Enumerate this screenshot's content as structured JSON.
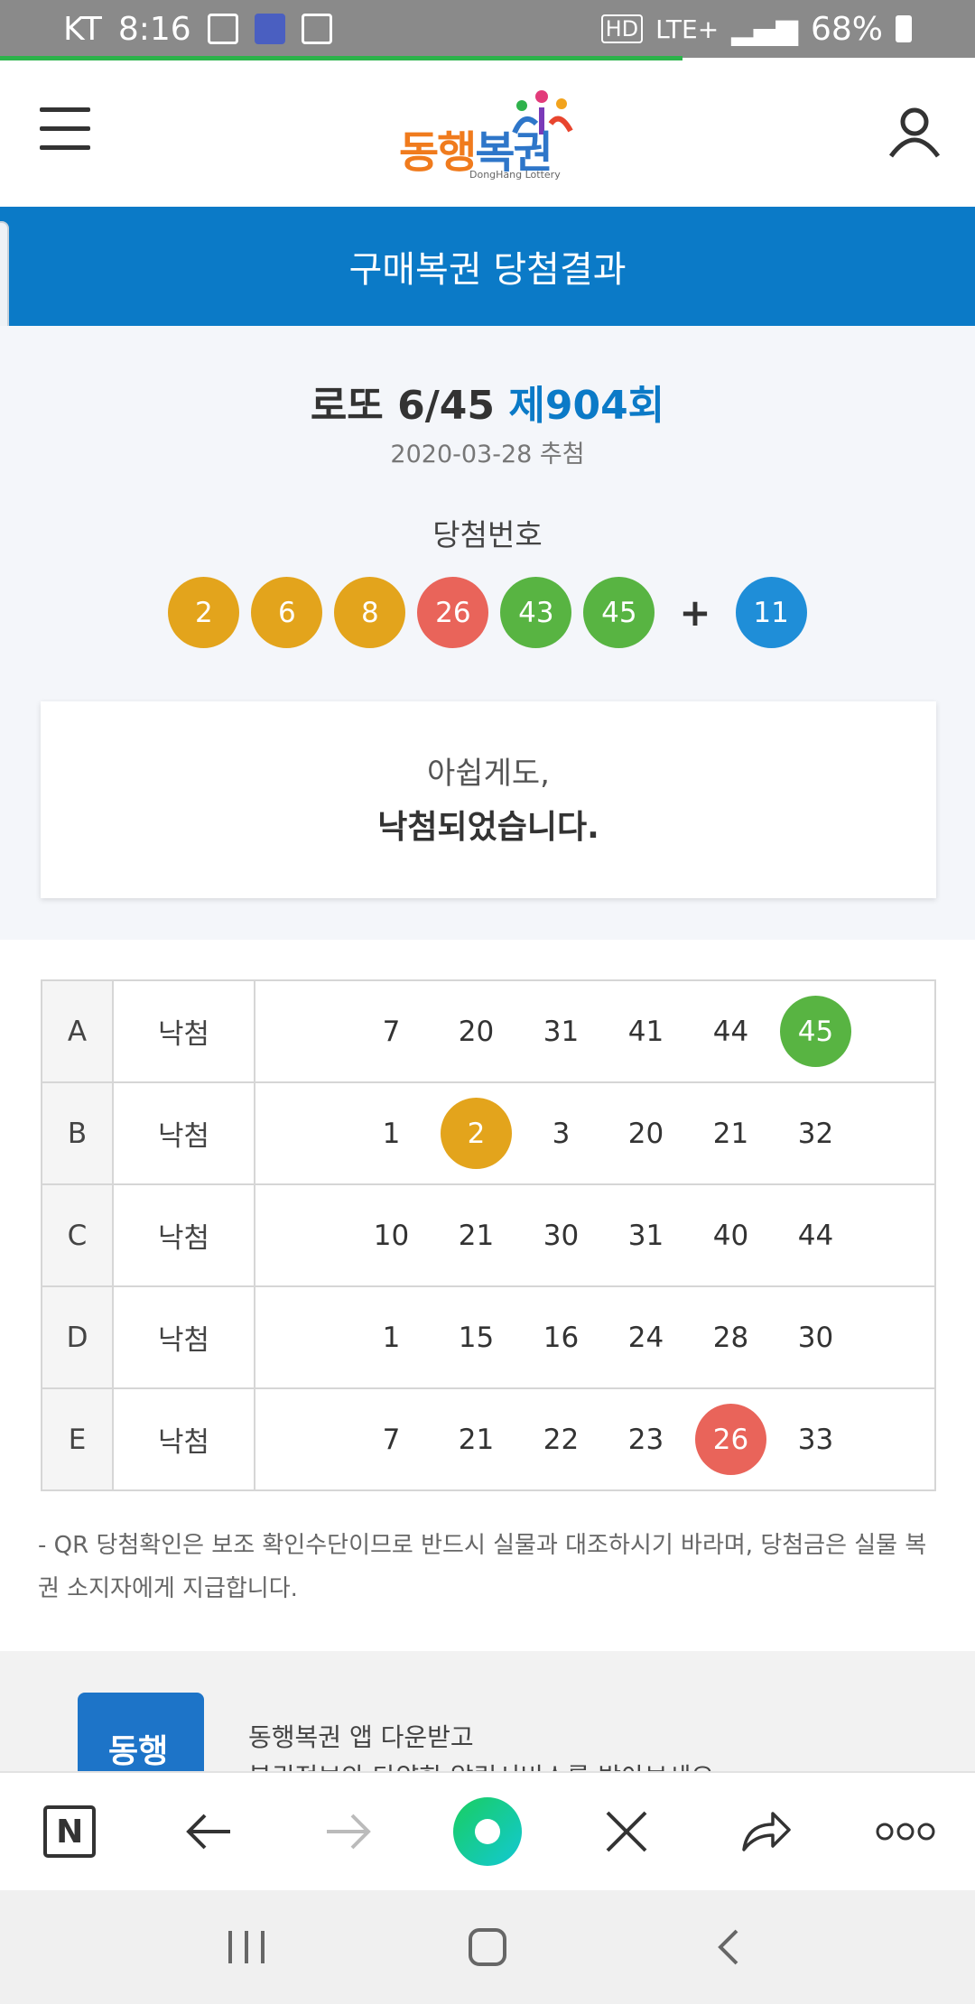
{
  "status_bar": {
    "carrier": "KT",
    "time": "8:16",
    "network": "LTE+",
    "battery": "68%"
  },
  "header": {
    "logo": "동행복권",
    "logo_sub": "DongHang Lottery"
  },
  "title_bar": {
    "title": "구매복권 당첨결과"
  },
  "draw": {
    "game": "로또 6/45",
    "round": "제904회",
    "date": "2020-03-28 추첨",
    "win_label": "당첨번호",
    "numbers": [
      "2",
      "6",
      "8",
      "26",
      "43",
      "45"
    ],
    "plus": "+",
    "bonus": "11"
  },
  "colors": {
    "yellow": "#e3a41c",
    "red": "#e9645a",
    "green": "#58b442",
    "blue": "#1f8ed8",
    "brand_blue": "#0b7ac7"
  },
  "message": {
    "line1": "아쉽게도,",
    "line2": "낙첨되었습니다."
  },
  "tickets": [
    {
      "letter": "A",
      "status": "낙첨",
      "numbers": [
        "7",
        "20",
        "31",
        "41",
        "44",
        "45"
      ]
    },
    {
      "letter": "B",
      "status": "낙첨",
      "numbers": [
        "1",
        "2",
        "3",
        "20",
        "21",
        "32"
      ]
    },
    {
      "letter": "C",
      "status": "낙첨",
      "numbers": [
        "10",
        "21",
        "30",
        "31",
        "40",
        "44"
      ]
    },
    {
      "letter": "D",
      "status": "낙첨",
      "numbers": [
        "1",
        "15",
        "16",
        "24",
        "28",
        "30"
      ]
    },
    {
      "letter": "E",
      "status": "낙첨",
      "numbers": [
        "7",
        "21",
        "22",
        "23",
        "26",
        "33"
      ]
    }
  ],
  "notice": "- QR 당첨확인은 보조 확인수단이므로 반드시 실물과 대조하시기 바라며, 당첨금은 실물 복권 소지자에게 지급합니다.",
  "banner": {
    "app_icon_text": "동행",
    "line1": "동행복권 앱 다운받고",
    "line2": "복권정보와 다양한 알림서비스를 받아보세요"
  },
  "toolbar": {
    "n_label": "N"
  },
  "page_load_progress": 0.7
}
